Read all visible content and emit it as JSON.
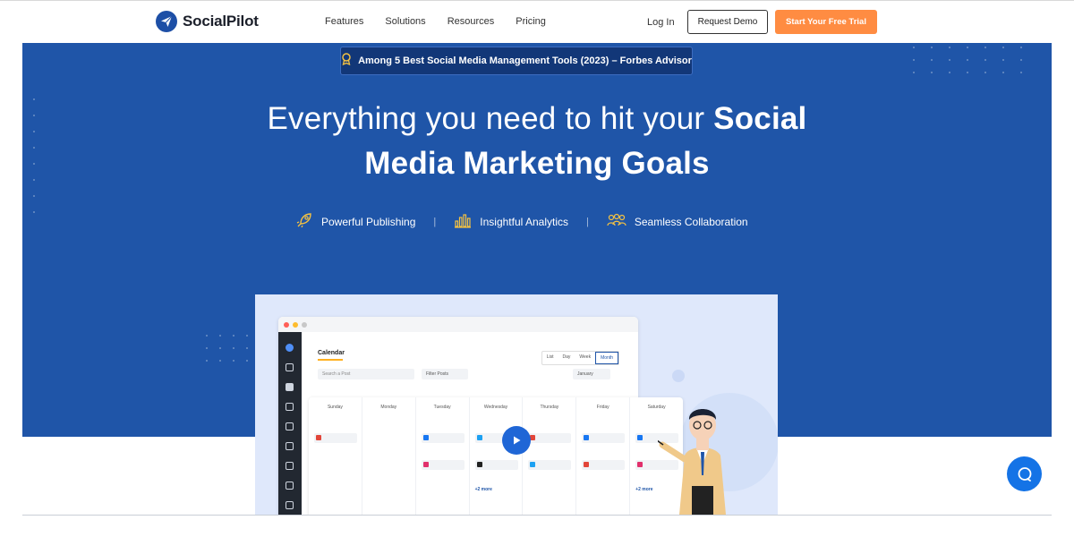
{
  "brand": {
    "name": "SocialPilot",
    "accent": "#1f55a8",
    "cta_color": "#ff8c42"
  },
  "nav": {
    "items": [
      "Features",
      "Solutions",
      "Resources",
      "Pricing"
    ],
    "login": "Log In",
    "demo": "Request Demo",
    "trial": "Start Your Free Trial"
  },
  "hero": {
    "badge": "Among 5 Best Social Media Management Tools (2023) – Forbes Advisor",
    "headline_light": "Everything you need to hit your ",
    "headline_bold_1": "Social",
    "headline_bold_2": "Media Marketing Goals",
    "features": [
      {
        "icon": "rocket-icon",
        "label": "Powerful Publishing"
      },
      {
        "icon": "bar-chart-icon",
        "label": "Insightful Analytics"
      },
      {
        "icon": "team-icon",
        "label": "Seamless Collaboration"
      }
    ],
    "separator": "|"
  },
  "preview": {
    "calendar_title": "Calendar",
    "views": [
      "List",
      "Day",
      "Week",
      "Month"
    ],
    "search_placeholder": "Search a Post",
    "filter": "Filter Posts",
    "month": "January",
    "days": [
      "Sunday",
      "Monday",
      "Tuesday",
      "Wednesday",
      "Thursday",
      "Friday",
      "Saturday"
    ],
    "more_label": "+2 more"
  }
}
